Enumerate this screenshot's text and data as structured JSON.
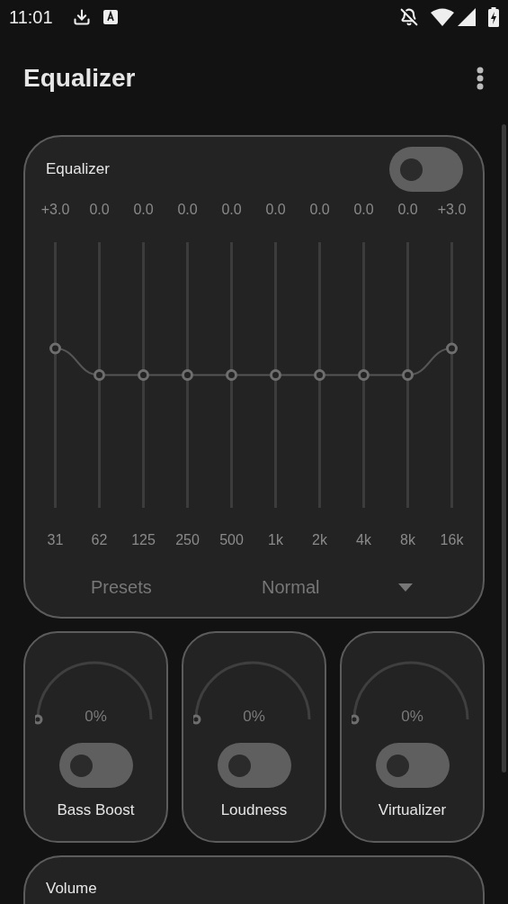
{
  "status_bar": {
    "time": "11:01"
  },
  "app_bar": {
    "title": "Equalizer"
  },
  "equalizer": {
    "title": "Equalizer",
    "on": false,
    "bands": [
      {
        "gain": "+3.0",
        "freq": "31",
        "level": 0.6
      },
      {
        "gain": "0.0",
        "freq": "62",
        "level": 0.5
      },
      {
        "gain": "0.0",
        "freq": "125",
        "level": 0.5
      },
      {
        "gain": "0.0",
        "freq": "250",
        "level": 0.5
      },
      {
        "gain": "0.0",
        "freq": "500",
        "level": 0.5
      },
      {
        "gain": "0.0",
        "freq": "1k",
        "level": 0.5
      },
      {
        "gain": "0.0",
        "freq": "2k",
        "level": 0.5
      },
      {
        "gain": "0.0",
        "freq": "4k",
        "level": 0.5
      },
      {
        "gain": "0.0",
        "freq": "8k",
        "level": 0.5
      },
      {
        "gain": "+3.0",
        "freq": "16k",
        "level": 0.6
      }
    ],
    "presets_label": "Presets",
    "preset": "Normal"
  },
  "effects": [
    {
      "label": "Bass Boost",
      "reading": "0%",
      "level": 0,
      "on": false
    },
    {
      "label": "Loudness",
      "reading": "0%",
      "level": 0,
      "on": false
    },
    {
      "label": "Virtualizer",
      "reading": "0%",
      "level": 0,
      "on": false
    }
  ],
  "volume": {
    "title": "Volume"
  }
}
